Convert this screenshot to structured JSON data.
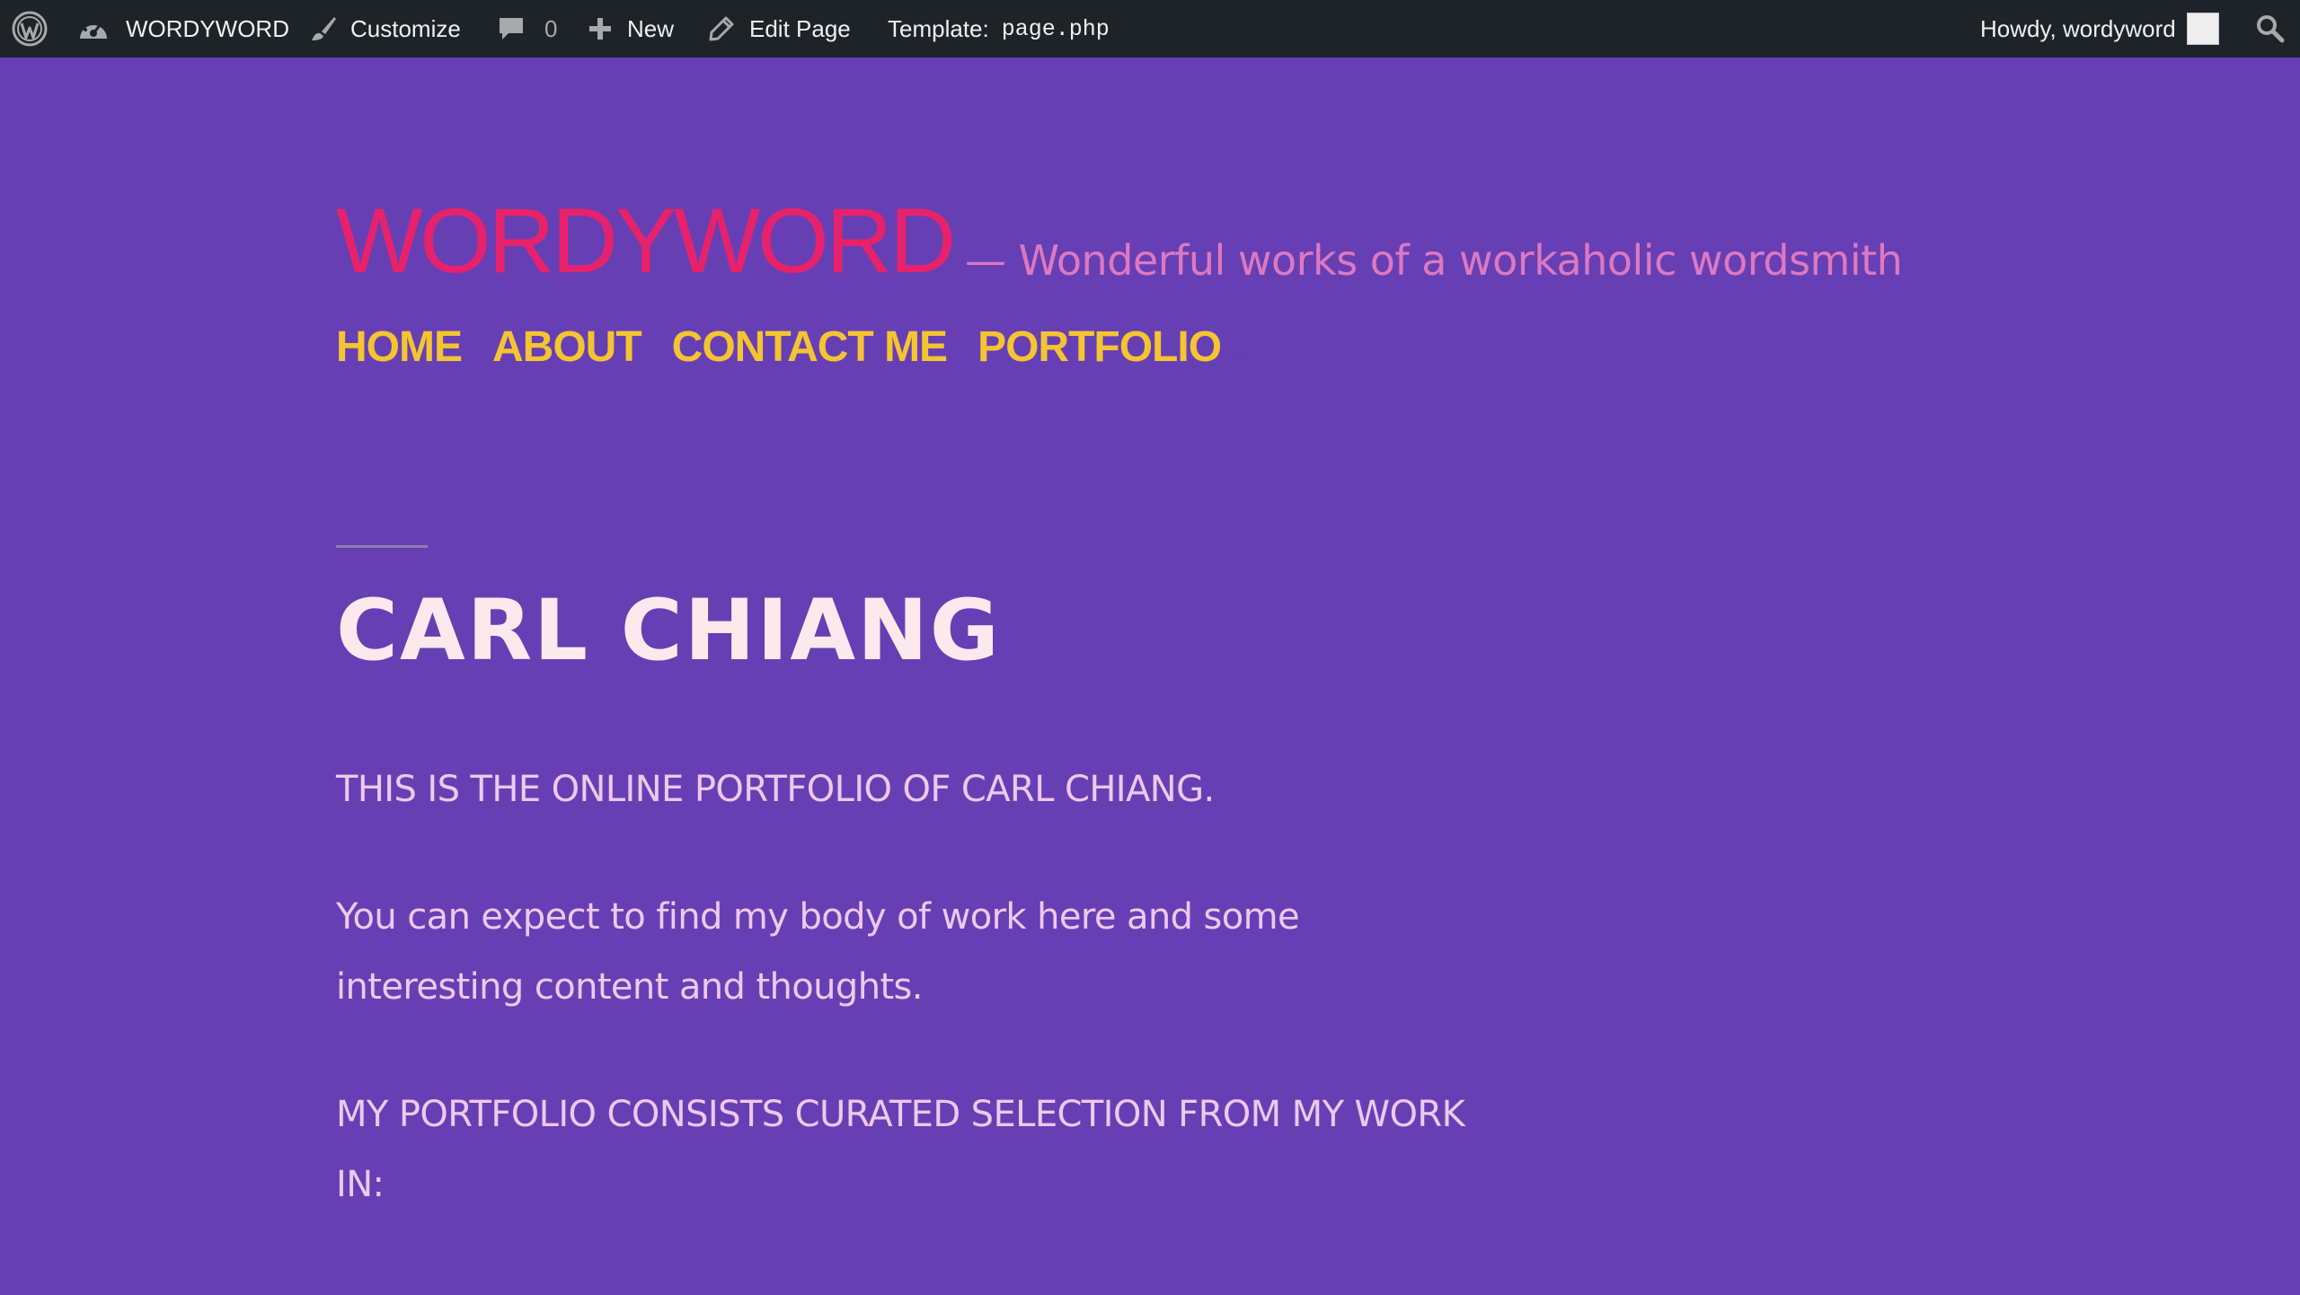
{
  "adminbar": {
    "site_name": "WORDYWORD",
    "customize_label": "Customize",
    "comments_count": "0",
    "new_label": "New",
    "edit_page_label": "Edit Page",
    "template_label": "Template:",
    "template_file": "page.php",
    "greeting": "Howdy, wordyword"
  },
  "header": {
    "site_title": "WORDYWORD",
    "tagline": "— Wonderful works of a workaholic wordsmith",
    "nav": {
      "home": "HOME",
      "about": "ABOUT",
      "contact": "CONTACT ME",
      "portfolio": "PORTFOLIO"
    }
  },
  "content": {
    "page_title": "CARL CHIANG",
    "paragraph1": "THIS  IS THE ONLINE  PORTFOLIO OF CARL CHIANG.",
    "paragraph2": "You can expect to find my body of work here and some interesting content and thoughts.",
    "paragraph3": "MY  PORTFOLIO CONSISTS CURATED SELECTION  FROM  MY WORK  IN:"
  },
  "colors": {
    "background": "#673fb4",
    "adminbar": "#1d2327",
    "site_title": "#e7226b",
    "tagline": "#dd79c0",
    "nav": "#f4c431",
    "page_title": "#fbe9ee",
    "body_text": "#ecc9ee"
  },
  "icons": {
    "wp_logo": "wordpress-logo-icon",
    "dashboard": "dashboard-gauge-icon",
    "customize": "paintbrush-icon",
    "comments": "comment-bubble-icon",
    "new": "plus-icon",
    "edit": "pencil-icon",
    "search": "search-icon",
    "submenu": "chevron-down-icon"
  }
}
